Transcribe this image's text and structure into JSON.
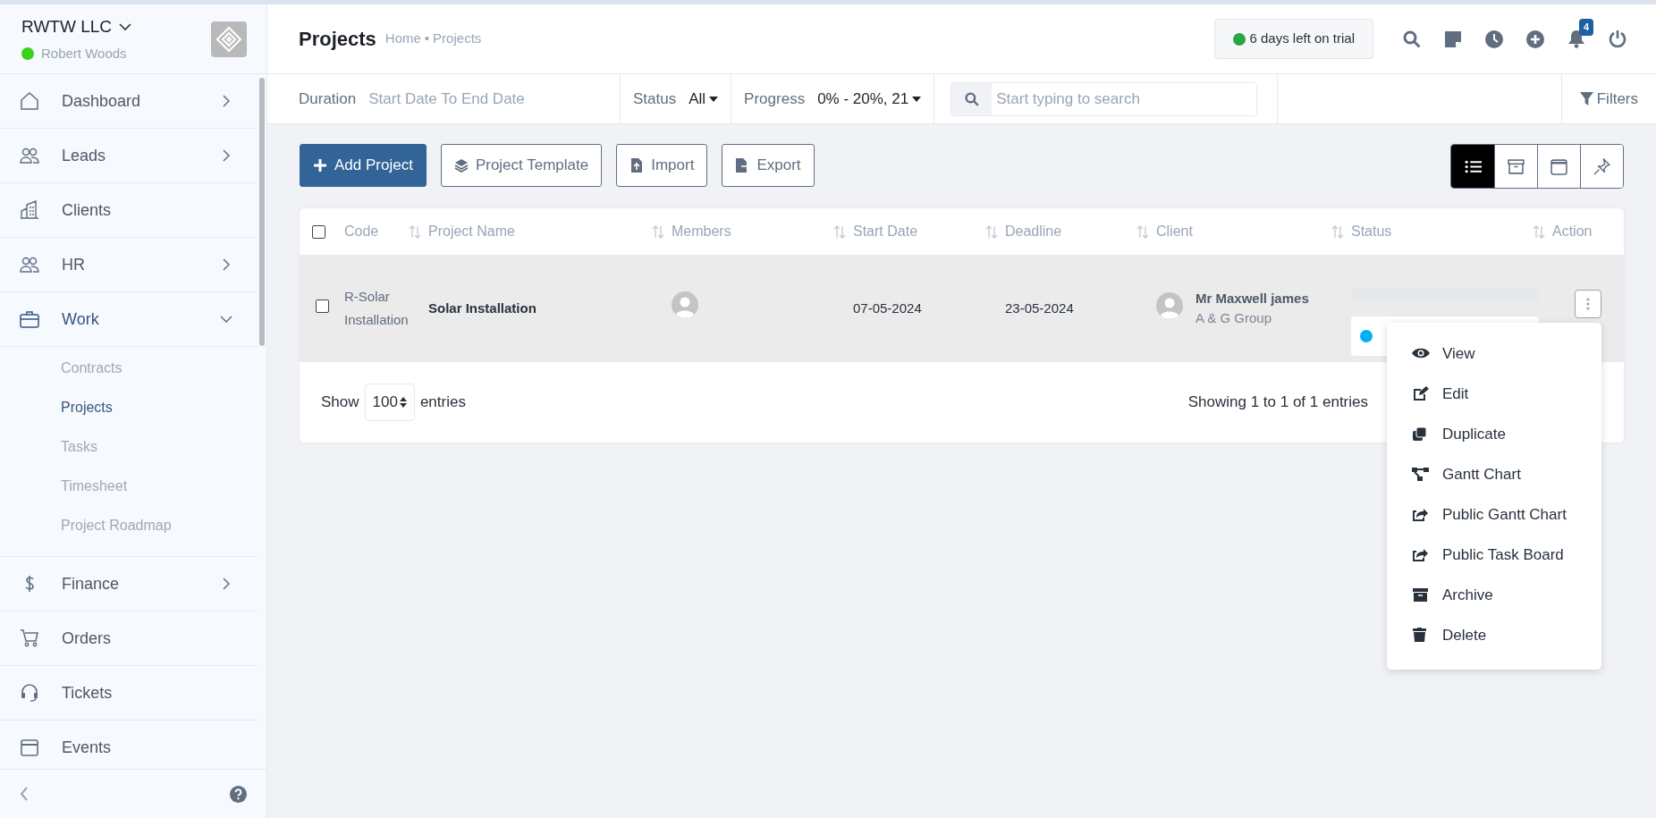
{
  "company": {
    "name": "RWTW LLC",
    "user": "Robert Woods",
    "online": true
  },
  "sidebar": {
    "items": [
      {
        "kind": "home",
        "label": "Dashboard",
        "expanded": false
      },
      {
        "kind": "people",
        "label": "Leads",
        "expanded": false
      },
      {
        "kind": "building",
        "label": "Clients"
      },
      {
        "kind": "people",
        "label": "HR",
        "expanded": false
      },
      {
        "kind": "briefcase",
        "label": "Work",
        "expanded": true,
        "children": [
          {
            "label": "Contracts",
            "selected": false
          },
          {
            "label": "Projects",
            "selected": true
          },
          {
            "label": "Tasks",
            "selected": false
          },
          {
            "label": "Timesheet",
            "selected": false
          },
          {
            "label": "Project Roadmap",
            "selected": false
          }
        ]
      },
      {
        "kind": "dollar",
        "label": "Finance",
        "expanded": false
      },
      {
        "kind": "cart",
        "label": "Orders"
      },
      {
        "kind": "headset",
        "label": "Tickets"
      },
      {
        "kind": "calendar",
        "label": "Events"
      }
    ]
  },
  "header": {
    "title": "Projects",
    "breadcrumb": [
      "Home",
      "Projects"
    ],
    "breadcrumb_separator": "•",
    "trial": "6 days left on trial",
    "notifications": "4"
  },
  "filters": {
    "duration_label": "Duration",
    "duration_value": "Start Date To End Date",
    "status_label": "Status",
    "status_value": "All",
    "progress_label": "Progress",
    "progress_value": "0% - 20%, 21",
    "search_placeholder": "Start typing to search",
    "filters_button": "Filters"
  },
  "actions": [
    "Add Project",
    "Project Template",
    "Import",
    "Export"
  ],
  "view_toggle": [
    {
      "kind": "list",
      "selected": true
    },
    {
      "kind": "archive",
      "selected": false
    },
    {
      "kind": "calendar",
      "selected": false
    },
    {
      "kind": "pin",
      "selected": false
    }
  ],
  "table": {
    "select_all_checked": false,
    "columns": [
      {
        "label": "Code",
        "sortable": true
      },
      {
        "label": "Project Name",
        "sortable": true
      },
      {
        "label": "Members",
        "sortable": true
      },
      {
        "label": "Start Date",
        "sortable": true
      },
      {
        "label": "Deadline",
        "sortable": true
      },
      {
        "label": "Client",
        "sortable": true
      },
      {
        "label": "Status",
        "sortable": true
      },
      {
        "label": "Action",
        "sortable": false
      }
    ],
    "rows": [
      {
        "checked": false,
        "code": "R-Solar Installation",
        "name": "Solar Installation",
        "start": "07-05-2024",
        "deadline": "23-05-2024",
        "client": "Mr Maxwell james",
        "company": "A & G Group"
      }
    ],
    "show_label": "Show",
    "page_size": "100",
    "entries_label": "entries",
    "summary": "Showing 1 to 1 of 1 entries"
  },
  "action_menu": [
    {
      "kind": "eye",
      "label": "View"
    },
    {
      "kind": "edit",
      "label": "Edit"
    },
    {
      "kind": "copy",
      "label": "Duplicate"
    },
    {
      "kind": "tree",
      "label": "Gantt Chart"
    },
    {
      "kind": "share",
      "label": "Public Gantt Chart"
    },
    {
      "kind": "share",
      "label": "Public Task Board"
    },
    {
      "kind": "archive",
      "label": "Archive"
    },
    {
      "kind": "trash",
      "label": "Delete"
    }
  ]
}
